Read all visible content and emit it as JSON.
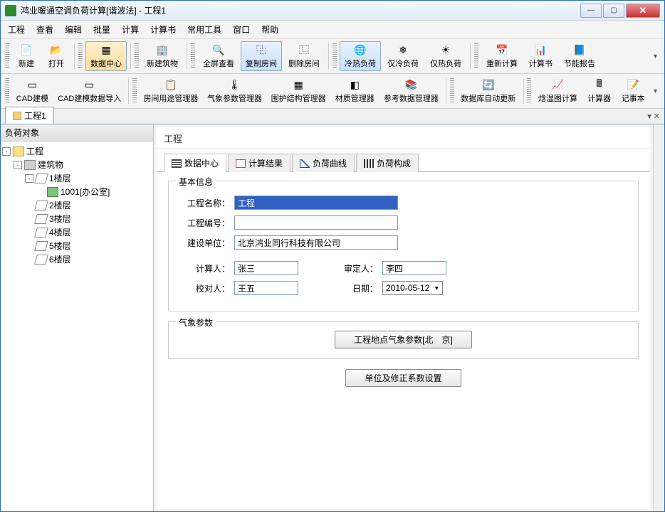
{
  "window": {
    "title": "鸿业暖通空调负荷计算[谐波法] - 工程1"
  },
  "menu": [
    "工程",
    "查看",
    "编辑",
    "批量",
    "计算",
    "计算书",
    "常用工具",
    "窗口",
    "帮助"
  ],
  "toolbar1": [
    {
      "label": "新建",
      "icon": "📄"
    },
    {
      "label": "打开",
      "icon": "📂"
    },
    {
      "label": "数据中心",
      "icon": "▦",
      "active": true
    },
    {
      "label": "新建筑物",
      "icon": "🏢"
    },
    {
      "label": "全屏查看",
      "icon": "🔍"
    },
    {
      "label": "复制房间",
      "icon": "⿻",
      "blue": true
    },
    {
      "label": "删除房间",
      "icon": "⿺"
    },
    {
      "label": "冷热负荷",
      "icon": "🌐",
      "blue": true
    },
    {
      "label": "仅冷负荷",
      "icon": "❄"
    },
    {
      "label": "仅热负荷",
      "icon": "☀"
    },
    {
      "label": "重新计算",
      "icon": "📅"
    },
    {
      "label": "计算书",
      "icon": "📊"
    },
    {
      "label": "节能报告",
      "icon": "📘"
    }
  ],
  "toolbar2": [
    {
      "label": "CAD建模",
      "icon": "▭"
    },
    {
      "label": "CAD建模数据导入",
      "icon": "▭"
    },
    {
      "label": "房间用途管理器",
      "icon": "📋"
    },
    {
      "label": "气象参数管理器",
      "icon": "🌡"
    },
    {
      "label": "围护结构管理器",
      "icon": "▦"
    },
    {
      "label": "材质管理器",
      "icon": "◧"
    },
    {
      "label": "参考数据管理器",
      "icon": "📚"
    },
    {
      "label": "数据库自动更新",
      "icon": "🔄"
    },
    {
      "label": "焓湿图计算",
      "icon": "📈"
    },
    {
      "label": "计算器",
      "icon": "🖩"
    },
    {
      "label": "记事本",
      "icon": "📝"
    }
  ],
  "docTab": "工程1",
  "sidebar": {
    "header": "负荷对象"
  },
  "tree": {
    "root": "工程",
    "building": "建筑物",
    "floors": [
      "1楼层",
      "2楼层",
      "3楼层",
      "4楼层",
      "5楼层",
      "6楼层"
    ],
    "room": "1001[办公室]"
  },
  "main": {
    "title": "工程",
    "tabs": [
      "数据中心",
      "计算结果",
      "负荷曲线",
      "负荷构成"
    ],
    "basic": {
      "legend": "基本信息",
      "name_label": "工程名称：",
      "name": "工程",
      "no_label": "工程编号：",
      "no": "",
      "unit_label": "建设单位：",
      "unit": "北京鸿业同行科技有限公司",
      "calc_label": "计算人：",
      "calc": "张三",
      "review_label": "审定人：",
      "review": "李四",
      "check_label": "校对人：",
      "check": "王五",
      "date_label": "日期：",
      "date": "2010-05-12"
    },
    "weather": {
      "legend": "气象参数",
      "btn": "工程地点气象参数[北　京]"
    },
    "unit_btn": "单位及修正系数设置"
  }
}
